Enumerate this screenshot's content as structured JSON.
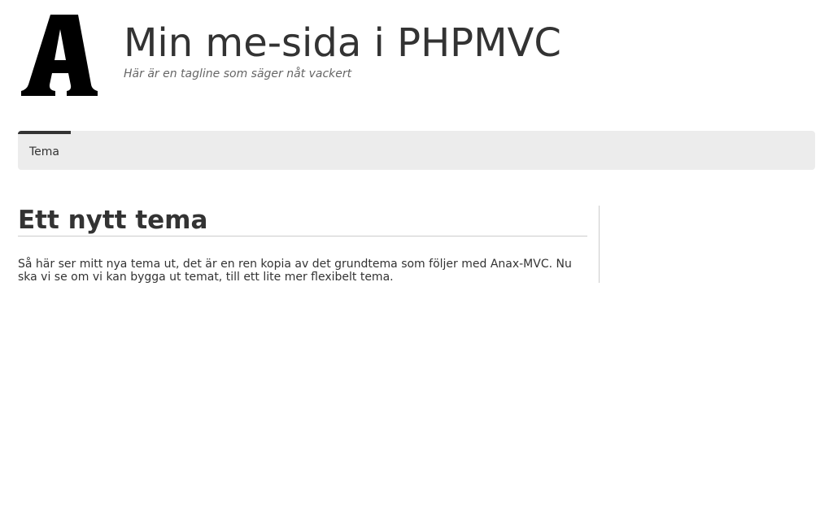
{
  "header": {
    "logo_icon": "anax-letter-a-logo",
    "logo_letter": "A",
    "site_title": "Min me-sida i PHPMVC",
    "site_tagline": "Här är en tagline som säger nåt vackert"
  },
  "navbar": {
    "items": [
      {
        "label": "Tema",
        "selected": true
      }
    ]
  },
  "main": {
    "heading": "Ett nytt tema",
    "body": "Så här ser mitt nya tema ut, det är en ren kopia av det grundtema som följer med Anax-MVC. Nu ska vi se om vi kan bygga ut temat, till ett lite mer flexibelt tema."
  },
  "colors": {
    "text": "#333333",
    "tagline": "#666666",
    "navbar_bg": "#ececec",
    "active_indicator": "#333333",
    "divider": "#cccccc"
  }
}
